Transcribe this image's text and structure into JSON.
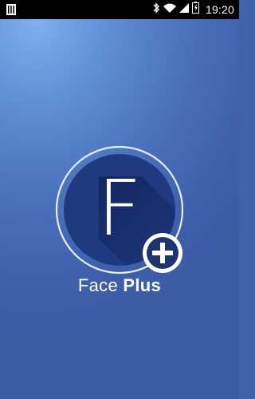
{
  "status_bar": {
    "time": "19:20",
    "icons": [
      "notification-icon",
      "bluetooth-icon",
      "wifi-icon",
      "signal-icon",
      "battery-icon"
    ]
  },
  "app": {
    "logo_letter": "F",
    "name_part1": "Face",
    "name_part2": "Plus"
  },
  "colors": {
    "status_bar": "#000000",
    "logo_circle": "#1f3a7f",
    "ring": "#e8eef8",
    "plus_badge": "#1d356f"
  }
}
